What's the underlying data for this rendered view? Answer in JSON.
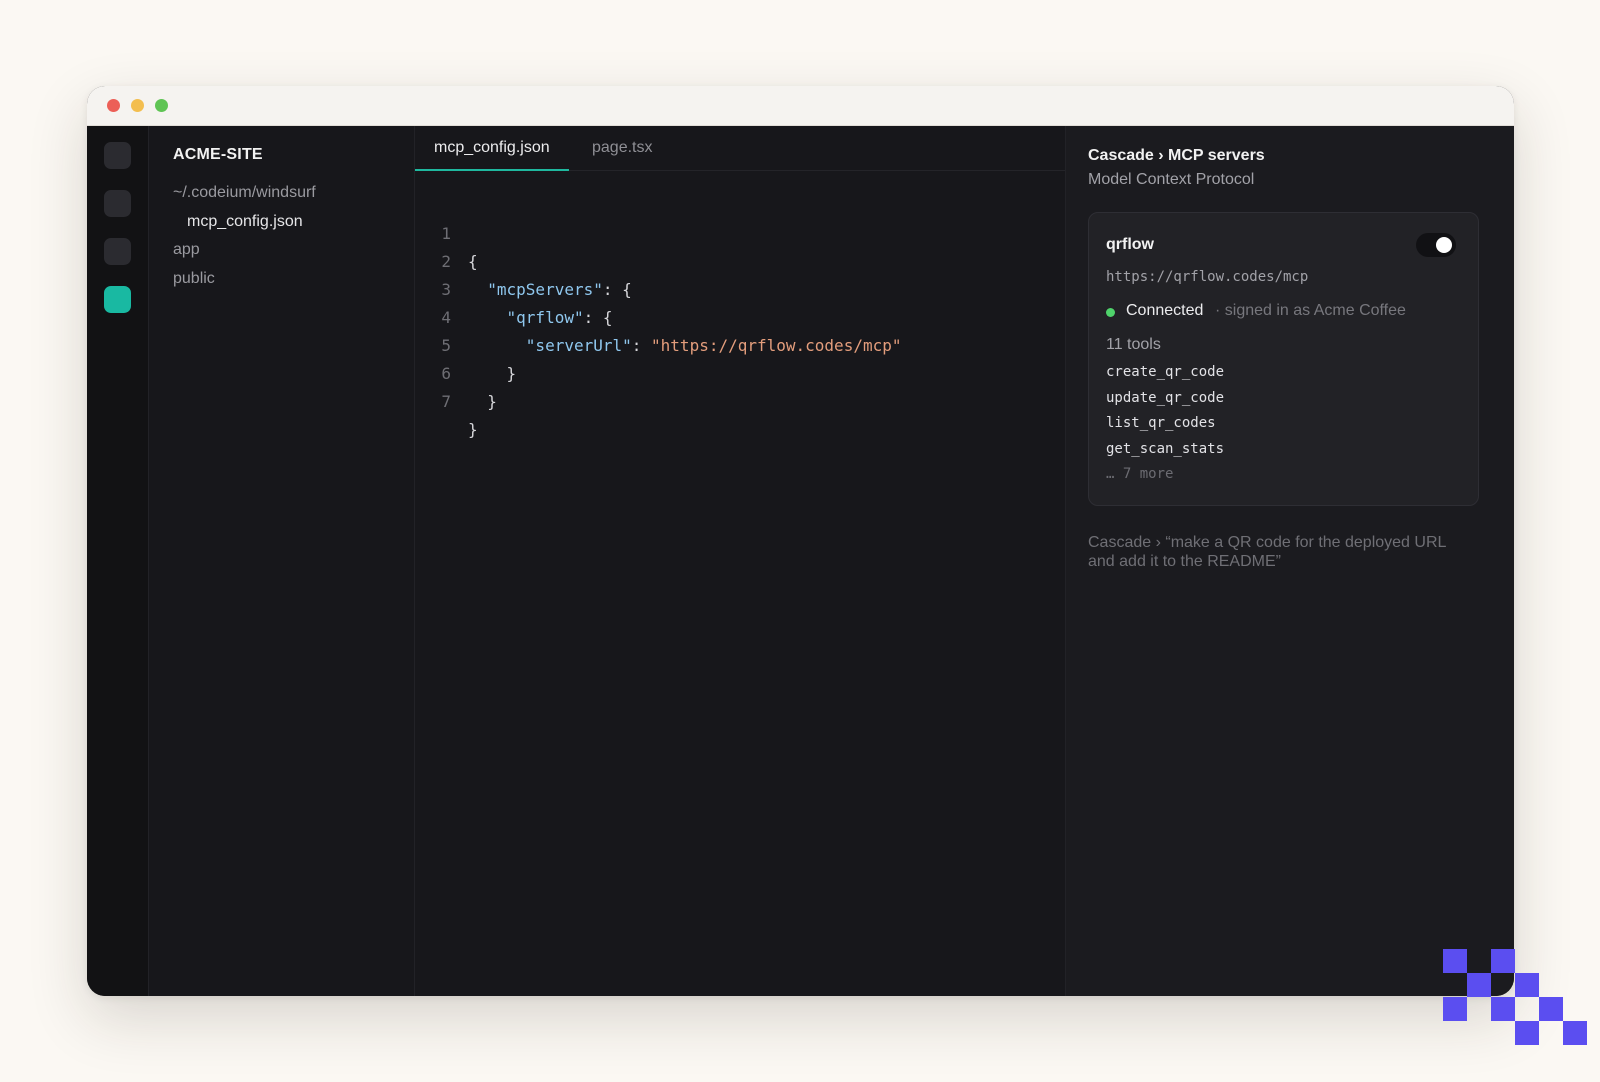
{
  "window": {
    "controls": [
      "close",
      "minimize",
      "zoom"
    ]
  },
  "activity_bar": {
    "items": [
      {
        "icon": "files-icon",
        "active": false
      },
      {
        "icon": "search-icon",
        "active": false
      },
      {
        "icon": "source-control-icon",
        "active": false
      },
      {
        "icon": "windsurf-icon",
        "active": true
      }
    ]
  },
  "explorer": {
    "project": "ACME-SITE",
    "items": [
      {
        "label": "~/.codeium/windsurf",
        "type": "folder"
      },
      {
        "label": "mcp_config.json",
        "type": "file"
      },
      {
        "label": "app",
        "type": "folder"
      },
      {
        "label": "public",
        "type": "folder"
      }
    ]
  },
  "editor": {
    "tabs": [
      {
        "label": "mcp_config.json",
        "active": true
      },
      {
        "label": "page.tsx",
        "active": false
      }
    ],
    "lines": [
      {
        "n": "1",
        "indent": "",
        "text": "{"
      },
      {
        "n": "2",
        "indent": "  ",
        "key": "\"mcpServers\"",
        "rest": ": {"
      },
      {
        "n": "3",
        "indent": "    ",
        "key": "\"qrflow\"",
        "rest": ": {"
      },
      {
        "n": "4",
        "indent": "      ",
        "key": "\"serverUrl\"",
        "sep": ": ",
        "str": "\"https://qrflow.codes/mcp\""
      },
      {
        "n": "5",
        "indent": "    ",
        "text": "}"
      },
      {
        "n": "6",
        "indent": "  ",
        "text": "}"
      },
      {
        "n": "7",
        "indent": "",
        "text": "}"
      }
    ]
  },
  "panel": {
    "title": "Cascade › MCP servers",
    "subtitle": "Model Context Protocol",
    "server": {
      "name": "qrflow",
      "enabled": true,
      "url": "https://qrflow.codes/mcp",
      "status": "Connected",
      "status_meta": "· signed in as Acme Coffee",
      "status_color": "#4fd36b",
      "tools_count": "11 tools",
      "tools": [
        "create_qr_code",
        "update_qr_code",
        "list_qr_codes",
        "get_scan_stats"
      ],
      "more": "… 7 more"
    },
    "prompt": "Cascade › “make a QR code for the deployed URL and add it to the README”"
  },
  "colors": {
    "accent": "#1fb89f",
    "deco": "#5b4ef0"
  }
}
